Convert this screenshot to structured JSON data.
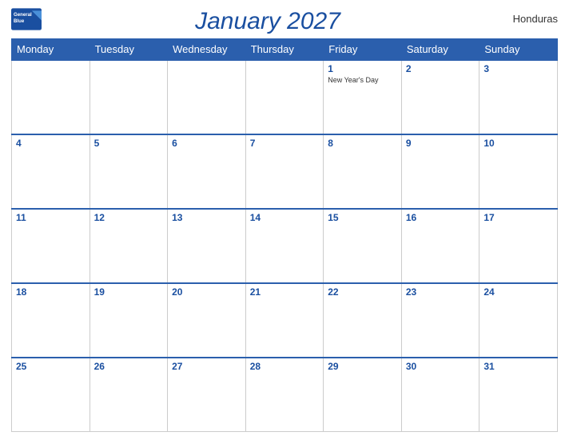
{
  "header": {
    "logo_line1": "General",
    "logo_line2": "Blue",
    "title": "January 2027",
    "country": "Honduras"
  },
  "days_of_week": [
    "Monday",
    "Tuesday",
    "Wednesday",
    "Thursday",
    "Friday",
    "Saturday",
    "Sunday"
  ],
  "weeks": [
    [
      {
        "num": "",
        "holiday": ""
      },
      {
        "num": "",
        "holiday": ""
      },
      {
        "num": "",
        "holiday": ""
      },
      {
        "num": "",
        "holiday": ""
      },
      {
        "num": "1",
        "holiday": "New Year's Day"
      },
      {
        "num": "2",
        "holiday": ""
      },
      {
        "num": "3",
        "holiday": ""
      }
    ],
    [
      {
        "num": "4",
        "holiday": ""
      },
      {
        "num": "5",
        "holiday": ""
      },
      {
        "num": "6",
        "holiday": ""
      },
      {
        "num": "7",
        "holiday": ""
      },
      {
        "num": "8",
        "holiday": ""
      },
      {
        "num": "9",
        "holiday": ""
      },
      {
        "num": "10",
        "holiday": ""
      }
    ],
    [
      {
        "num": "11",
        "holiday": ""
      },
      {
        "num": "12",
        "holiday": ""
      },
      {
        "num": "13",
        "holiday": ""
      },
      {
        "num": "14",
        "holiday": ""
      },
      {
        "num": "15",
        "holiday": ""
      },
      {
        "num": "16",
        "holiday": ""
      },
      {
        "num": "17",
        "holiday": ""
      }
    ],
    [
      {
        "num": "18",
        "holiday": ""
      },
      {
        "num": "19",
        "holiday": ""
      },
      {
        "num": "20",
        "holiday": ""
      },
      {
        "num": "21",
        "holiday": ""
      },
      {
        "num": "22",
        "holiday": ""
      },
      {
        "num": "23",
        "holiday": ""
      },
      {
        "num": "24",
        "holiday": ""
      }
    ],
    [
      {
        "num": "25",
        "holiday": ""
      },
      {
        "num": "26",
        "holiday": ""
      },
      {
        "num": "27",
        "holiday": ""
      },
      {
        "num": "28",
        "holiday": ""
      },
      {
        "num": "29",
        "holiday": ""
      },
      {
        "num": "30",
        "holiday": ""
      },
      {
        "num": "31",
        "holiday": ""
      }
    ]
  ]
}
